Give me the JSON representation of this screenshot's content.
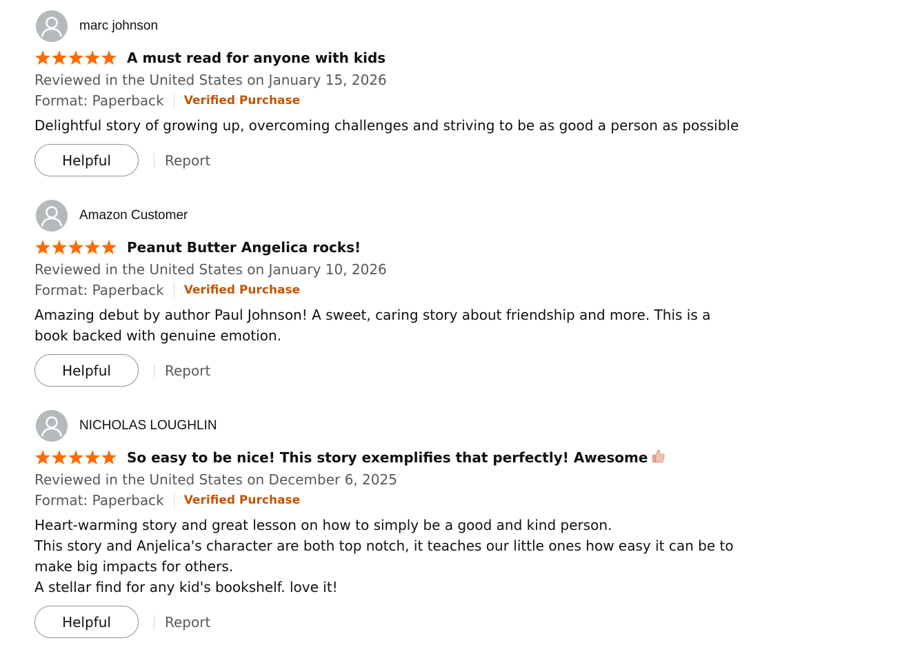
{
  "reviews": [
    {
      "profile_name": "marc johnson",
      "rating": 5,
      "title": "A must read for anyone with kids",
      "title_emoji": "",
      "date_line": "Reviewed in the United States on January 15, 2026",
      "format": "Format: Paperback",
      "verified": "Verified Purchase",
      "body": "Delightful story of growing up, overcoming challenges and striving to be as good a person as possible",
      "helpful_label": "Helpful",
      "report_label": "Report"
    },
    {
      "profile_name": "Amazon Customer",
      "rating": 5,
      "title": "Peanut Butter Angelica rocks!",
      "title_emoji": "",
      "date_line": "Reviewed in the United States on January 10, 2026",
      "format": "Format: Paperback",
      "verified": "Verified Purchase",
      "body": "Amazing debut by author Paul Johnson! A sweet, caring story about friendship and more. This is a book backed with genuine emotion.",
      "helpful_label": "Helpful",
      "report_label": "Report"
    },
    {
      "profile_name": "NICHOLAS LOUGHLIN",
      "rating": 5,
      "title": "So easy to be nice! This story exemplifies that perfectly! Awesome",
      "title_emoji": "thumbs-up-icon",
      "date_line": "Reviewed in the United States on December 6, 2025",
      "format": "Format: Paperback",
      "verified": "Verified Purchase",
      "body_lines": [
        "Heart-warming story and great lesson on how to simply be a good and kind person.",
        "This story and Anjelica's character are both top notch, it teaches our little ones how easy it can be to make big impacts for others.",
        "A stellar find for any kid's bookshelf. love it!"
      ],
      "helpful_label": "Helpful",
      "report_label": "Report"
    }
  ],
  "colors": {
    "star": "#ff6b00",
    "verified": "#c45500",
    "muted_text": "#565959",
    "avatar_bg": "#b4b9bb"
  }
}
